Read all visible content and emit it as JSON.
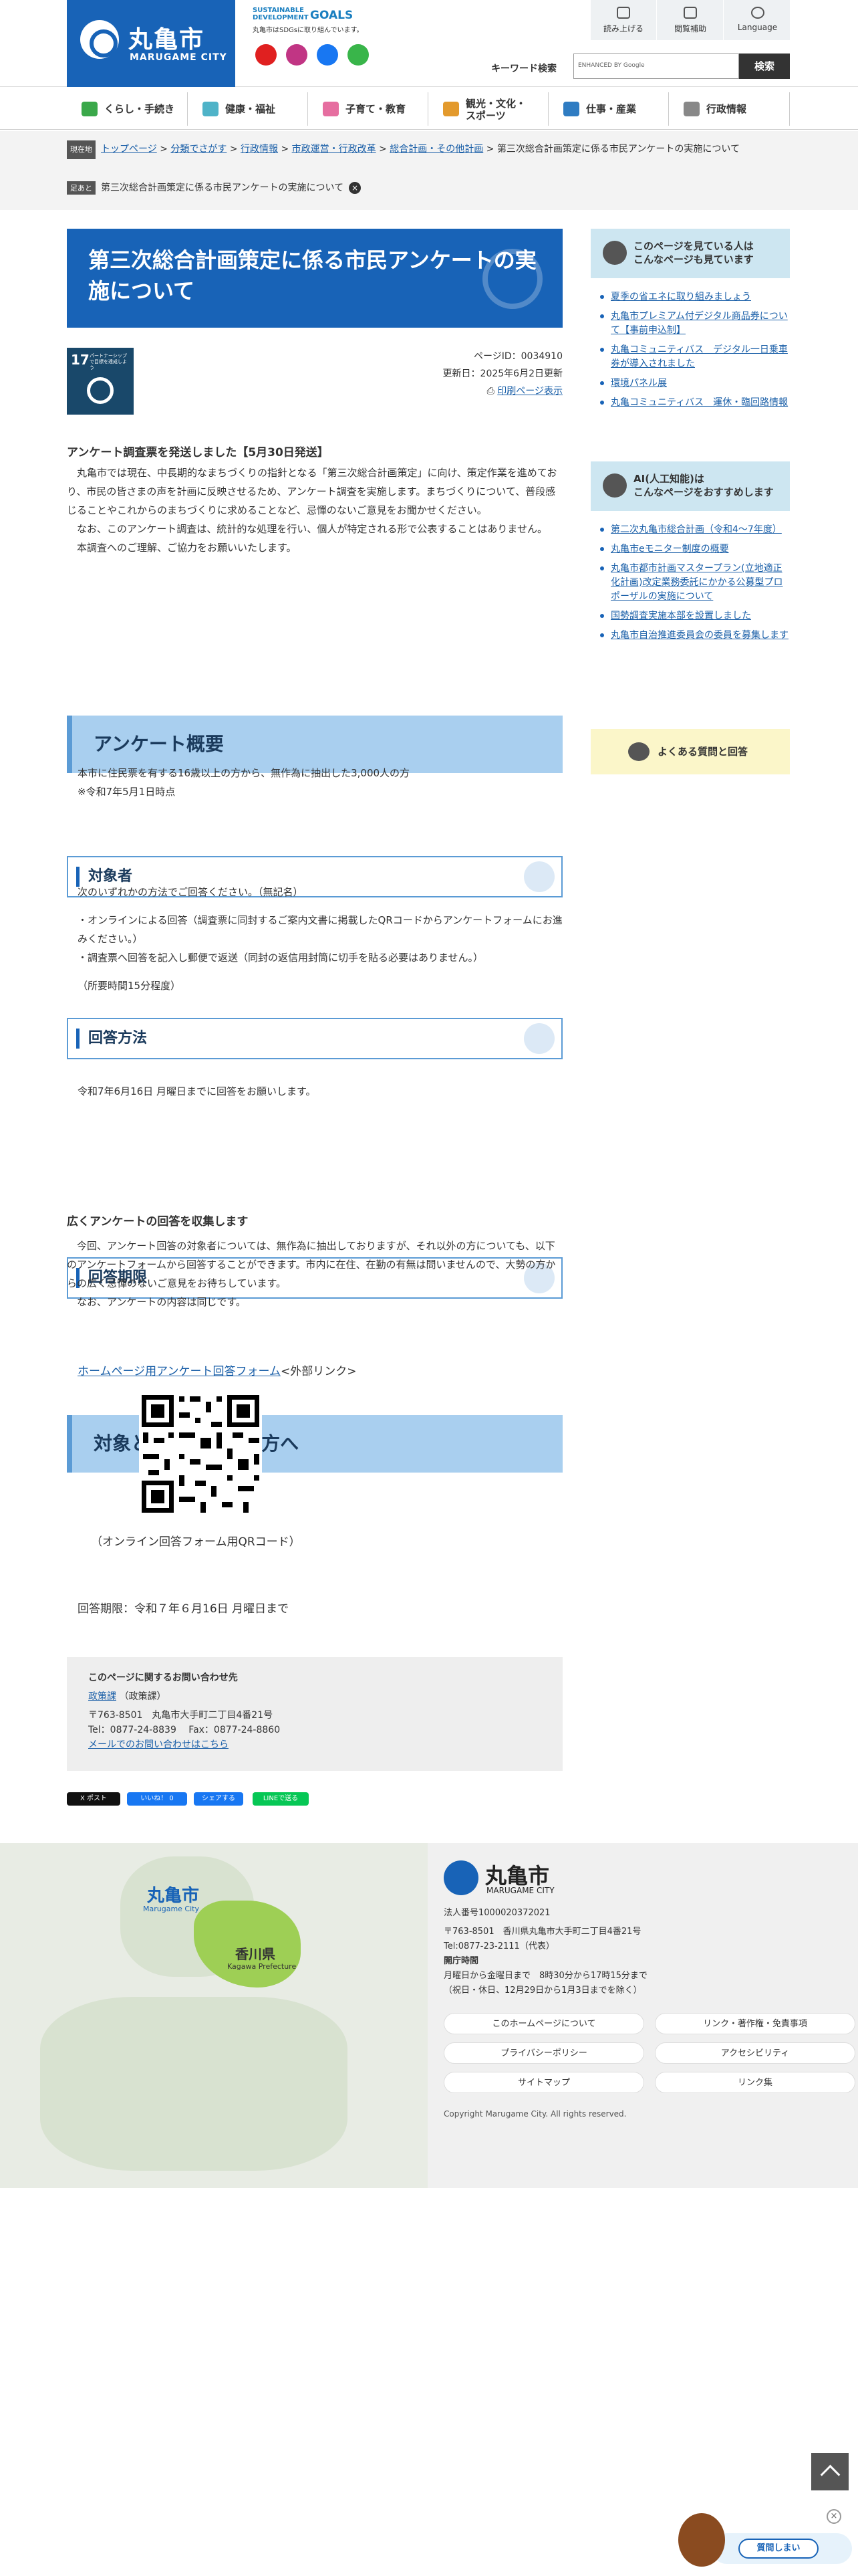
{
  "header": {
    "logo_text": "丸亀市",
    "logo_en": "MARUGAME CITY",
    "sdgs_a": "SUSTAINABLE\nDEVELOPMENT",
    "sdgs_goals": "GOALS",
    "sdgs_sub": "丸亀市はSDGsに取り組んでいます。",
    "utils": [
      "読み上げる",
      "閲覧補助",
      "Language"
    ],
    "keyword_label": "キーワード検索",
    "search_brand": "ENHANCED BY Google",
    "search_button": "検索"
  },
  "gnav": [
    {
      "label": "くらし・手続き",
      "color": "#3aa84a"
    },
    {
      "label": "健康・福祉",
      "color": "#4fb3c8"
    },
    {
      "label": "子育て・教育",
      "color": "#e66ea0"
    },
    {
      "label": "観光・文化・\nスポーツ",
      "color": "#e39a2d"
    },
    {
      "label": "仕事・産業",
      "color": "#2f7cc2"
    },
    {
      "label": "行政情報",
      "color": "#888888"
    }
  ],
  "breadcrumb": {
    "tag_current": "現在地",
    "links": [
      "トップページ",
      "分類でさがす",
      "行政情報",
      "市政運営・行政改革",
      "総合計画・その他計画"
    ],
    "current": "第三次総合計画策定に係る市民アンケートの実施について",
    "tag_tracked": "足あと",
    "tracked": "第三次総合計画策定に係る市民アンケートの実施について",
    "sep": ">"
  },
  "page": {
    "title": "第三次総合計画策定に係る市民アンケートの実施について",
    "sdg_num": "17",
    "sdg_text": "パートナーシップで目標を達成しよう",
    "page_id": "ページID：0034910",
    "updated": "更新日：2025年6月2日更新",
    "print": "印刷ページ表示",
    "intro_title": "アンケート調査票を発送しました【5月30日発送】",
    "intro_p1": "丸亀市では現在、中長期的なまちづくりの指針となる「第三次総合計画策定」に向け、策定作業を進めており、市民の皆さまの声を計画に反映させるため、アンケート調査を実施します。まちづくりについて、普段感じることやこれからのまちづくりに求めることなど、忌憚のないご意見をお聞かせください。",
    "intro_p2": "なお、このアンケート調査は、統計的な処理を行い、個人が特定される形で公表することはありません。",
    "intro_p3": "本調査へのご理解、ご協力をお願いいたします。",
    "h2_outline": "アンケート概要",
    "h3_target": "対象者",
    "target_p": "本市に住民票を有する16歳以上の方から、無作為に抽出した3,000人の方",
    "target_note": "※令和7年5月1日時点",
    "h3_method": "回答方法",
    "method_p1": "次のいずれかの方法でご回答ください。（無記名）",
    "method_p2": "・オンラインによる回答（調査票に同封するご案内文書に掲載したQRコードからアンケートフォームにお進みください。）",
    "method_p3": "・調査票へ回答を記入し郵便で返送（同封の返信用封筒に切手を貼る必要はありません。）",
    "method_p4": "（所要時間15分程度）",
    "h3_deadline": "回答期限",
    "deadline_p": "令和7年6月16日 月曜日までに回答をお願いします。",
    "h2_others": "対象とならなかった方へ",
    "others_title": "広くアンケートの回答を収集します",
    "others_p1": "今回、アンケート回答の対象者については、無作為に抽出しておりますが、それ以外の方についても、以下のアンケートフォームから回答することができます。市内に在住、在勤の有無は問いませんので、大勢の方からの広く忌憚のないご意見をお待ちしています。",
    "others_p2": "なお、アンケートの内容は同じです。",
    "form_link": "ホームページ用アンケート回答フォーム",
    "form_ext": "<外部リンク>",
    "qr_caption": "（オンライン回答フォーム用QRコード）",
    "deadline2": "回答期限：令和７年６月16日 月曜日まで"
  },
  "contact": {
    "title": "このページに関するお問い合わせ先",
    "dept_link": "政策課",
    "dept": "（政策課）",
    "address": "〒763-8501　丸亀市大手町二丁目4番21号",
    "tel": "Tel：0877-24-8839　 Fax：0877-24-8860",
    "mail": "メールでのお問い合わせはこちら"
  },
  "share": [
    "X ポスト",
    "いいね！ 0",
    "シェアする",
    "LINEで送る"
  ],
  "side": {
    "viewed_title": "このページを見ている人は\nこんなページも見ています",
    "viewed": [
      "夏季の省エネに取り組みましょう",
      "丸亀市プレミアム付デジタル商品券について【事前申込制】",
      "丸亀コミュニティバス　デジタル一日乗車券が導入されました",
      "環境パネル展",
      "丸亀コミュニティバス　運休・臨回路情報"
    ],
    "ai_title": "AI(人工知能)は\nこんなページをおすすめします",
    "ai": [
      "第二次丸亀市総合計画（令和4～7年度）",
      "丸亀市eモニター制度の概要",
      "丸亀市都市計画マスタープラン(立地適正化計画)改定業務委託にかかる公募型プロポーザルの実施について",
      "国勢調査実施本部を設置しました",
      "丸亀市自治推進委員会の委員を募集します"
    ],
    "faq": "よくある質問と回答"
  },
  "footer": {
    "map_city": "丸亀市",
    "map_city_en": "Marugame City",
    "map_pref": "香川県",
    "map_pref_en": "Kagawa Prefecture",
    "logo_text": "丸亀市",
    "logo_en": "MARUGAME CITY",
    "corp_no": "法人番号1000020372021",
    "address": "〒763-8501　香川県丸亀市大手町二丁目4番21号",
    "tel": "Tel:0877-23-2111（代表）",
    "hours_title": "開庁時間",
    "hours": "月曜日から金曜日まで　8時30分から17時15分まで",
    "hours_note": "（祝日・休日、12月29日から1月3日までを除く）",
    "links": [
      "このホームページについて",
      "リンク・著作権・免責事項",
      "プライバシーポリシー",
      "アクセシビリティ",
      "サイトマップ",
      "リンク集"
    ],
    "copyright": "Copyright Marugame City. All rights reserved."
  },
  "chat": {
    "button": "質問しまい",
    "close": "×"
  }
}
